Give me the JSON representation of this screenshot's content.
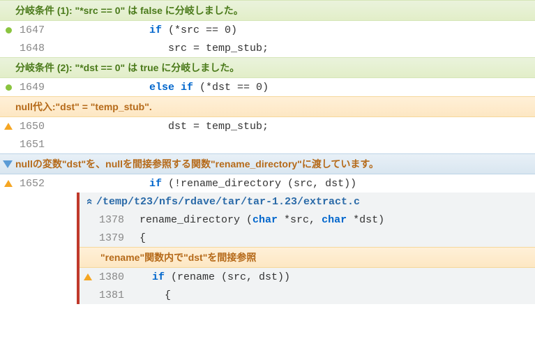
{
  "annotations": {
    "branch1": "分岐条件 (1): \"*src == 0\" は false に分岐しました。",
    "branch2": "分岐条件 (2): \"*dst == 0\" は true に分岐しました。",
    "nullassign": "null代入:\"dst\" = \"temp_stub\".",
    "nullderef": "nullの変数\"dst\"を、nullを間接参照する関数\"rename_directory\"に渡しています。",
    "nested_deref": "\"rename\"関数内で\"dst\"を間接参照"
  },
  "lines": {
    "l1647_no": "1647",
    "l1648_no": "1648",
    "l1649_no": "1649",
    "l1650_no": "1650",
    "l1651_no": "1651",
    "l1652_no": "1652",
    "n1378_no": "1378",
    "n1379_no": "1379",
    "n1380_no": "1380",
    "n1381_no": "1381"
  },
  "code": {
    "l1647_a": "            if",
    "l1647_b": " (*src == 0)",
    "l1648": "               src = temp_stub;",
    "l1649_a": "            else",
    "l1649_b": " if",
    "l1649_c": " (*dst == 0)",
    "l1650": "               dst = temp_stub;",
    "l1651": "",
    "l1652_a": "            if",
    "l1652_b": " (!rename_directory (src, dst))",
    "n1378_a": "rename_directory (",
    "n1378_b": "char",
    "n1378_c": " *src, ",
    "n1378_d": "char",
    "n1378_e": " *dst)",
    "n1379": "{",
    "n1380_a": "  if",
    "n1380_b": " (rename (src, dst))",
    "n1381": "    {"
  },
  "nested": {
    "filepath": "/temp/t23/nfs/rdave/tar/tar-1.23/extract.c"
  }
}
